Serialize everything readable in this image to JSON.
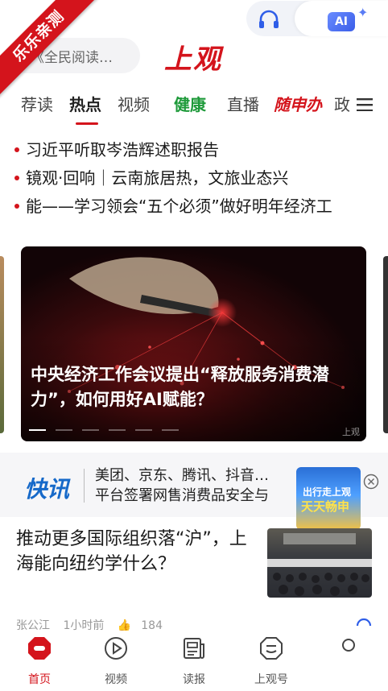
{
  "ribbon": {
    "label": "乐乐亲测"
  },
  "header": {
    "search_text": "《全民阅读…",
    "brand": "上观",
    "ai_label": "AI"
  },
  "tabs": [
    {
      "label": "荐读"
    },
    {
      "label": "热点",
      "active": true
    },
    {
      "label": "视频"
    },
    {
      "label": "健康"
    },
    {
      "label": "直播"
    },
    {
      "label": "随申办"
    },
    {
      "label": "政"
    }
  ],
  "headlines": [
    "习近平听取岑浩辉述职报告",
    "镜观·回响｜云南旅居热，文旅业态兴",
    "能——学习领会“五个必须”做好明年经济工"
  ],
  "banner": {
    "title": "中央经济工作会议提出“释放服务消费潜力”，如何用好AI赋能？",
    "watermark": "上观",
    "slides": 6,
    "active_slide": 1
  },
  "flash": {
    "logo": "快讯",
    "text_line1": "美团、京东、腾讯、抖音…",
    "text_line2": "平台签署网售消费品安全与",
    "promo_line1": "出行走上观",
    "promo_line2": "天天畅申"
  },
  "article": {
    "title": "推动更多国际组织落“沪”，上海能向纽约学什么？",
    "source": "张公江",
    "time": "1小时前",
    "likes": "184"
  },
  "bottom_nav": [
    {
      "label": "首页",
      "icon": "home-icon",
      "active": true
    },
    {
      "label": "视频",
      "icon": "video-icon"
    },
    {
      "label": "读报",
      "icon": "newspaper-icon"
    },
    {
      "label": "上观号",
      "icon": "account-icon"
    },
    {
      "label": "",
      "icon": "profile-icon"
    }
  ],
  "colors": {
    "brand_red": "#d4141c",
    "health_green": "#1e9a3a",
    "flash_blue": "#1669c9"
  }
}
